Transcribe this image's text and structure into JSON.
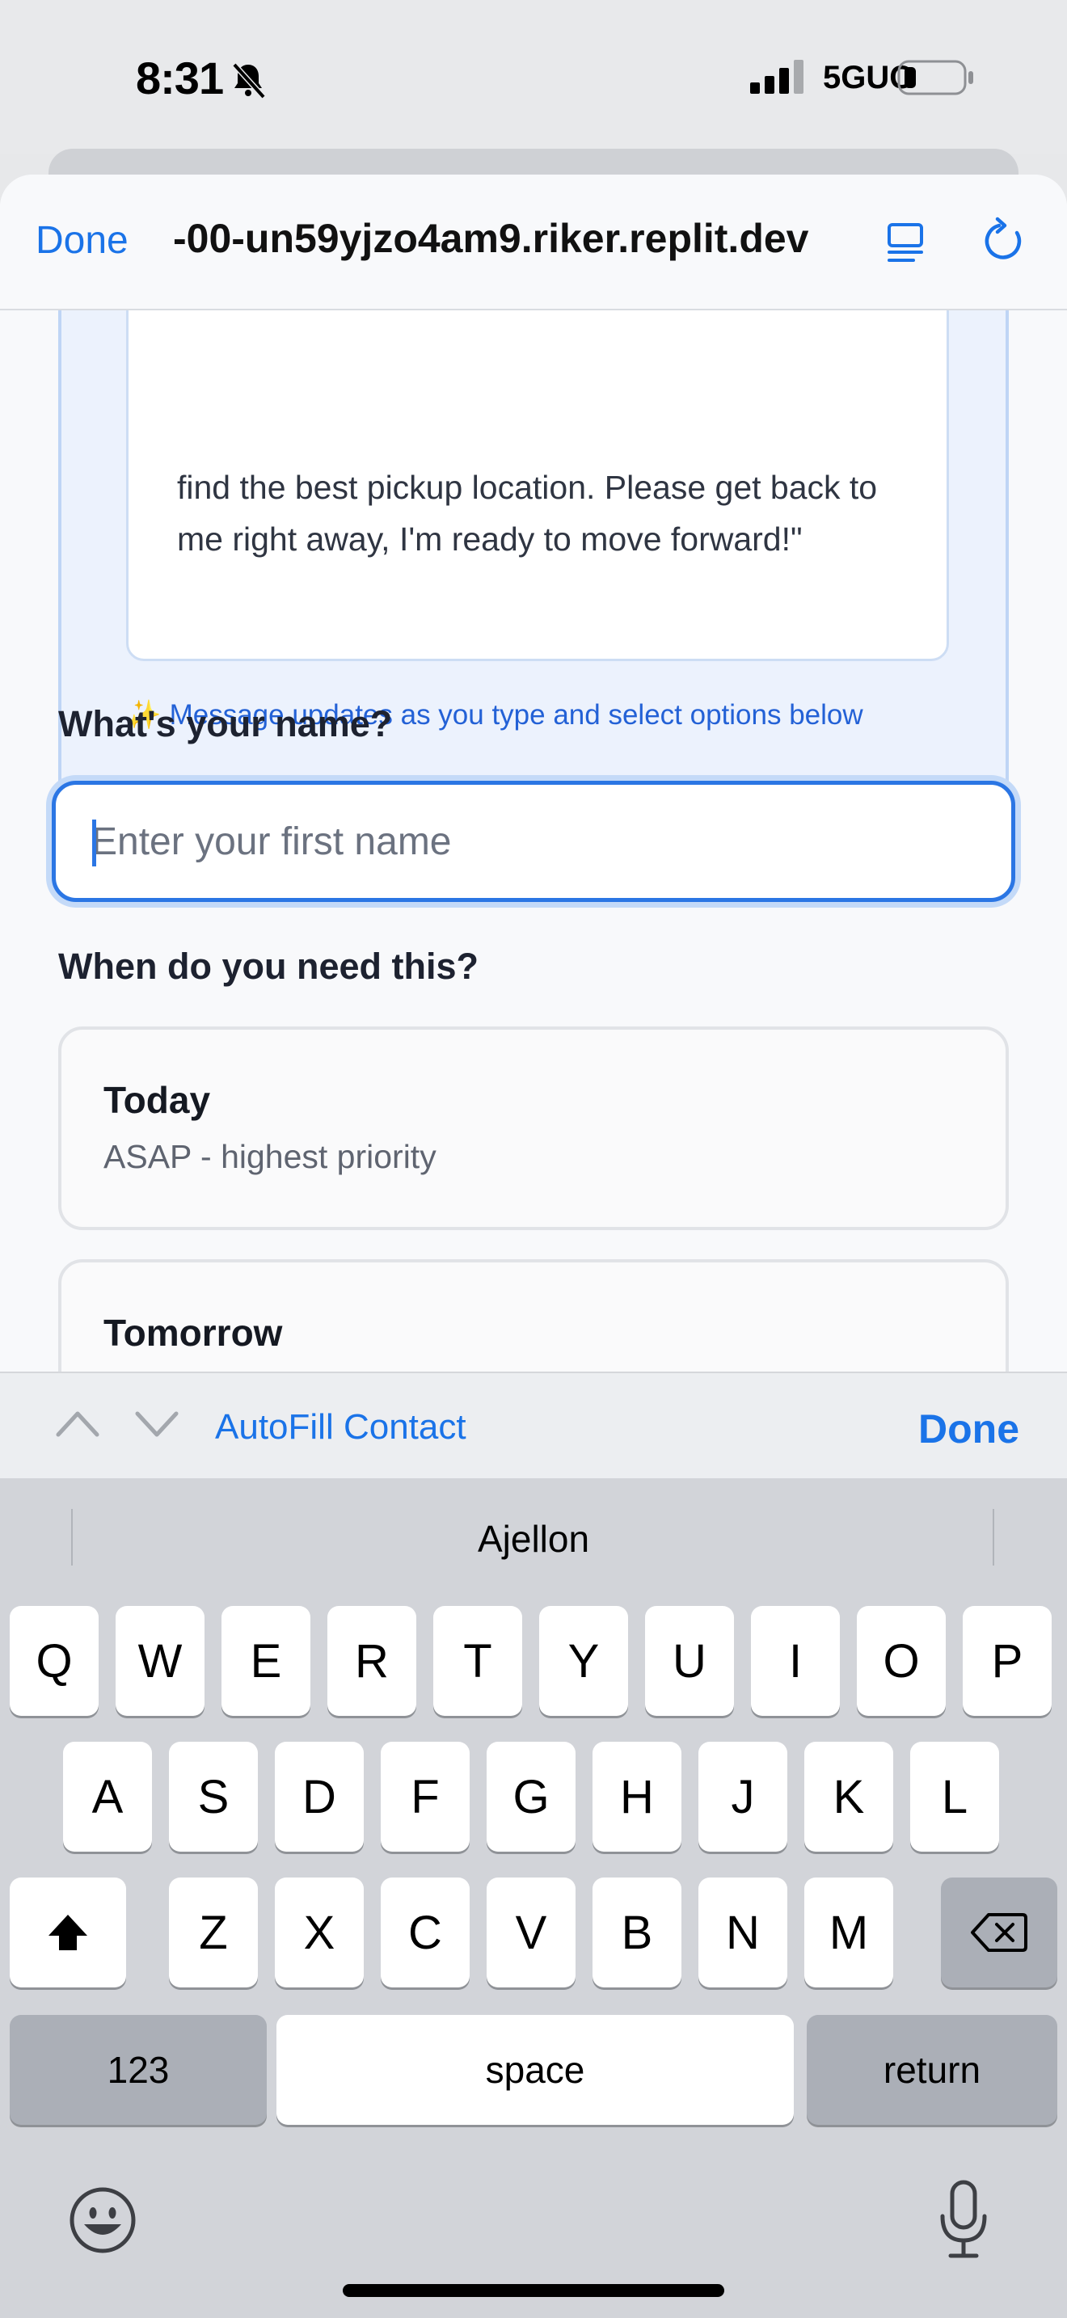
{
  "status_bar": {
    "time": "8:31",
    "network": "5GUC"
  },
  "browser": {
    "done_label": "Done",
    "url": "-00-un59yjzo4am9.riker.replit.dev"
  },
  "preview": {
    "message_lines": "find the best pickup location. Please get back to me right away, I'm ready to move forward!\"",
    "hint": "Message updates as you type and select options below"
  },
  "form": {
    "name_label": "What's your name?",
    "name_placeholder": "Enter your first name",
    "name_value": "",
    "when_label": "When do you need this?",
    "options": [
      {
        "title": "Today",
        "subtitle": "ASAP - highest priority"
      },
      {
        "title": "Tomorrow",
        "subtitle": ""
      }
    ]
  },
  "accessory": {
    "autofill_label": "AutoFill Contact",
    "done_label": "Done"
  },
  "keyboard": {
    "prediction": "Ajellon",
    "row1": [
      "Q",
      "W",
      "E",
      "R",
      "T",
      "Y",
      "U",
      "I",
      "O",
      "P"
    ],
    "row2": [
      "A",
      "S",
      "D",
      "F",
      "G",
      "H",
      "J",
      "K",
      "L"
    ],
    "row3": [
      "Z",
      "X",
      "C",
      "V",
      "B",
      "N",
      "M"
    ],
    "numbers_label": "123",
    "space_label": "space",
    "return_label": "return"
  },
  "colors": {
    "accent": "#1a73e8",
    "focus_border": "#2b76e4",
    "card_bg": "#ecf2fd"
  }
}
